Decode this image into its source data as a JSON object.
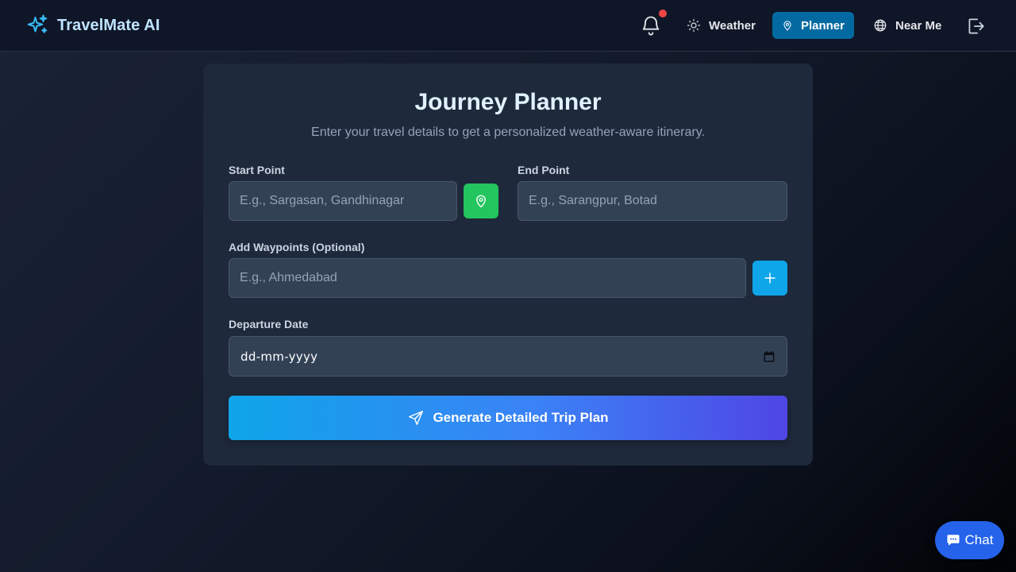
{
  "navbar": {
    "brand": "TravelMate AI",
    "brand_color": "#7dd3fc",
    "items": [
      {
        "label": "Weather",
        "icon": "sun-icon",
        "active": false
      },
      {
        "label": "Planner",
        "icon": "map-pin-icon",
        "active": true
      },
      {
        "label": "Near Me",
        "icon": "globe-icon",
        "active": false
      }
    ],
    "notification_icon": "bell-icon",
    "notification_dot_color": "#ef4444",
    "logout_icon": "logout-icon",
    "active_color": "#0369a1"
  },
  "planner": {
    "title": "Journey Planner",
    "subtitle": "Enter your travel details to get a personalized weather-aware itinerary.",
    "start": {
      "label": "Start Point",
      "value": "",
      "placeholder": "E.g., Sargasan, Gandhinagar"
    },
    "end": {
      "label": "End Point",
      "value": "",
      "placeholder": "E.g., Sarangpur, Botad"
    },
    "waypoints": {
      "label": "Add Waypoints (Optional)",
      "value": "",
      "placeholder": "E.g., Ahmedabad"
    },
    "departure": {
      "label": "Departure Date",
      "value": "dd-mm-yyyy"
    },
    "generate_label": "Generate Detailed Trip Plan",
    "location_button_color": "#22c55e",
    "add_button_color": "#0ea5e9"
  },
  "chat": {
    "label": "Chat",
    "icon": "chat-bubble-icon",
    "color": "#2563eb"
  }
}
